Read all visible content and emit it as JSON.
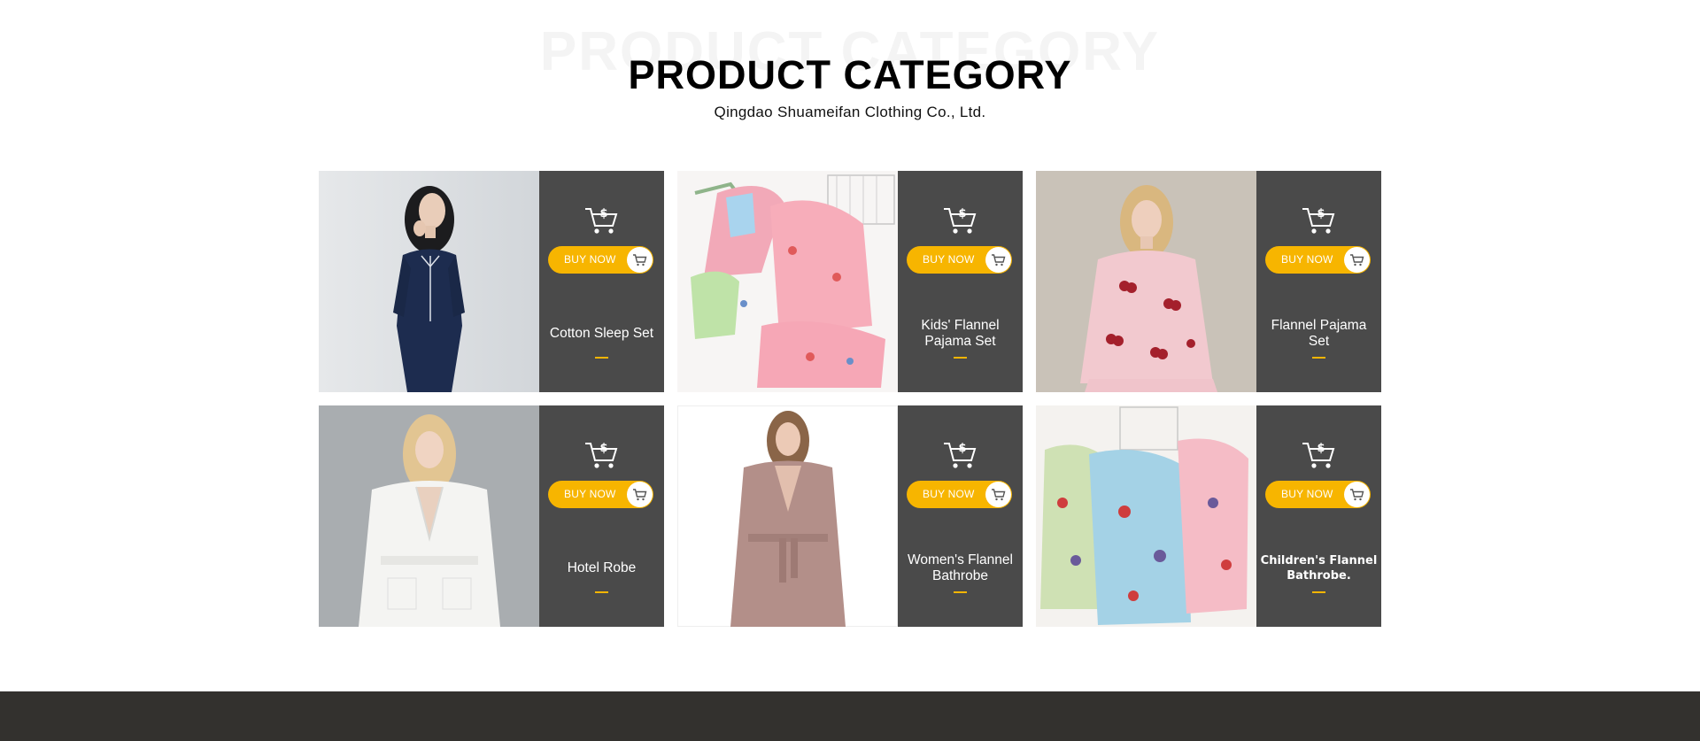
{
  "header": {
    "background_title": "PRODUCT CATEGORY",
    "title": "PRODUCT CATEGORY",
    "subtitle": "Qingdao Shuameifan Clothing Co., Ltd."
  },
  "colors": {
    "accent": "#f7b500",
    "panel": "#4a4a4a",
    "footer": "#33312e"
  },
  "products": [
    {
      "name": "Cotton Sleep Set",
      "button_label": "BUY NOW"
    },
    {
      "name": "Kids' Flannel Pajama Set",
      "button_label": "BUY NOW"
    },
    {
      "name": "Flannel Pajama Set",
      "button_label": "BUY NOW"
    },
    {
      "name": "Hotel Robe",
      "button_label": "BUY NOW"
    },
    {
      "name": "Women's Flannel Bathrobe",
      "button_label": "BUY NOW"
    },
    {
      "name": "Children's Flannel Bathrobe.",
      "button_label": "BUY NOW"
    }
  ],
  "icons": {
    "panel_icon": "shopping-cart-dollar-icon",
    "button_icon": "shopping-cart-icon"
  }
}
